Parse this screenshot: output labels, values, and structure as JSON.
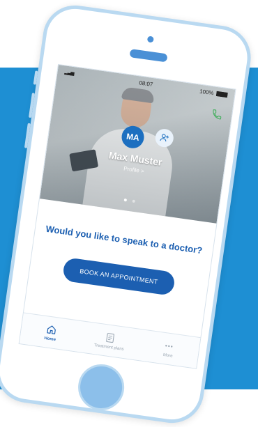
{
  "status_bar": {
    "signal": "▂▃▅",
    "time": "08:07",
    "battery_percent": "100%"
  },
  "doctor_card": {
    "avatar_initials": "MA",
    "name": "Max Muster",
    "profile_link": "Profile >",
    "carousel_dots": 2,
    "active_dot": 1
  },
  "main": {
    "question": "Would you like to speak to a doctor?",
    "book_button_label": "BOOK AN APPOINTMENT"
  },
  "tabs": [
    {
      "label": "Home",
      "icon": "home-icon",
      "active": true
    },
    {
      "label": "Treatment plans",
      "icon": "document-icon",
      "active": false
    },
    {
      "label": "More",
      "icon": "more-icon",
      "active": false
    }
  ],
  "colors": {
    "brand_blue": "#1c5fb1",
    "background_band": "#1e8fd3",
    "phone_frame": "#b9d9f1"
  }
}
